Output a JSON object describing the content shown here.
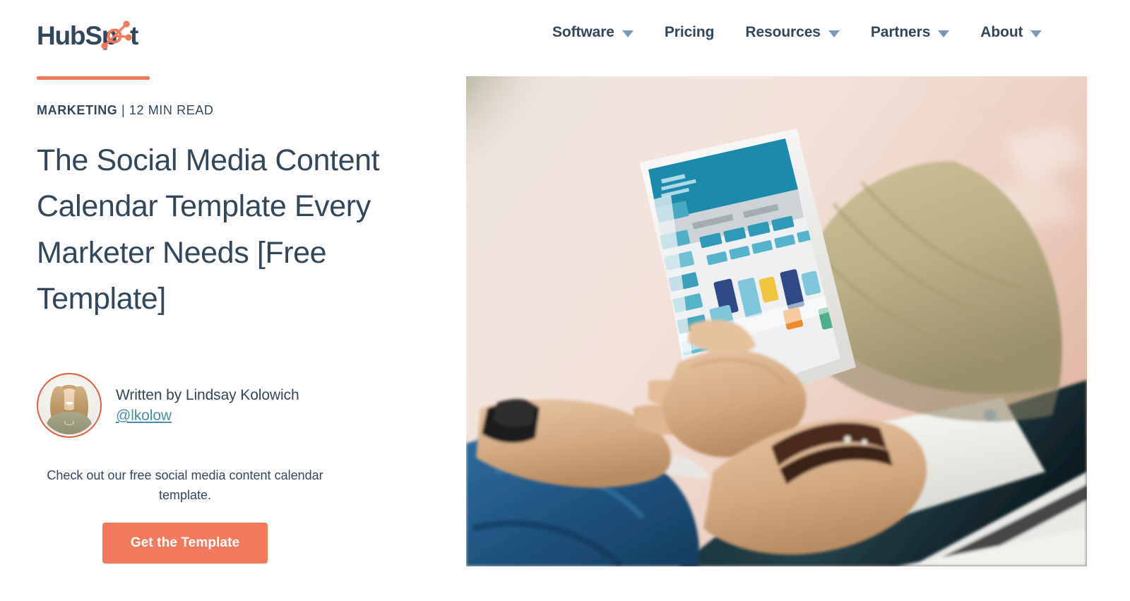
{
  "brand": {
    "logo_text_1": "HubSp",
    "logo_text_2": "t",
    "logo_name": "HubSpot",
    "accent_color": "#f2795b",
    "navy_color": "#33475b",
    "link_color": "#4b8ca5"
  },
  "nav": {
    "items": [
      {
        "label": "Software",
        "has_caret": true
      },
      {
        "label": "Pricing",
        "has_caret": false
      },
      {
        "label": "Resources",
        "has_caret": true
      },
      {
        "label": "Partners",
        "has_caret": true
      },
      {
        "label": "About",
        "has_caret": true
      }
    ]
  },
  "article": {
    "category": "MARKETING",
    "separator": " | ",
    "read_time": "12 MIN READ",
    "headline": "The Social Media Content Calendar Template Every Marketer Needs [Free Template]"
  },
  "author": {
    "byline": "Written by Lindsay Kolowich",
    "handle": "@lkolow",
    "avatar_alt": "Lindsay Kolowich headshot"
  },
  "cta": {
    "text": "Check out our free social media content calendar template.",
    "button_label": "Get the Template"
  },
  "hero": {
    "alt": "Person sitting on floor holding a tablet showing a colorful content calendar, with a notebook and laptop nearby"
  }
}
